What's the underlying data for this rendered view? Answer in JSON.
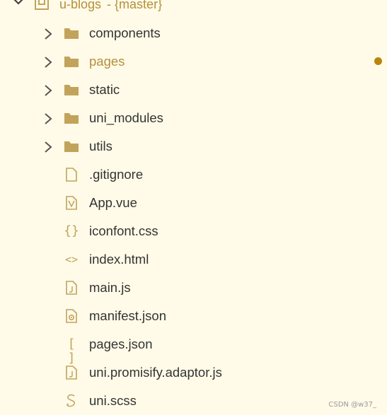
{
  "root": {
    "name": "u-blogs",
    "branch": "- {master}",
    "expanded": true
  },
  "items": [
    {
      "label": "components",
      "type": "folder",
      "icon": "folder-icon"
    },
    {
      "label": "pages",
      "type": "folder",
      "icon": "folder-icon",
      "modified": true
    },
    {
      "label": "static",
      "type": "folder",
      "icon": "folder-icon"
    },
    {
      "label": "uni_modules",
      "type": "folder",
      "icon": "folder-icon"
    },
    {
      "label": "utils",
      "type": "folder",
      "icon": "folder-icon"
    },
    {
      "label": ".gitignore",
      "type": "file",
      "icon": "file-icon"
    },
    {
      "label": "App.vue",
      "type": "file",
      "icon": "vue-file-icon"
    },
    {
      "label": "iconfont.css",
      "type": "file",
      "icon": "css-braces-icon"
    },
    {
      "label": "index.html",
      "type": "file",
      "icon": "html-brackets-icon"
    },
    {
      "label": "main.js",
      "type": "file",
      "icon": "js-file-icon"
    },
    {
      "label": "manifest.json",
      "type": "file",
      "icon": "manifest-gear-icon"
    },
    {
      "label": "pages.json",
      "type": "file",
      "icon": "json-brackets-icon"
    },
    {
      "label": "uni.promisify.adaptor.js",
      "type": "file",
      "icon": "js-file-icon"
    },
    {
      "label": "uni.scss",
      "type": "file",
      "icon": "scss-icon"
    }
  ],
  "watermark": "CSDN @w37_",
  "colors": {
    "background": "#fffbe8",
    "folder": "#c2a35c",
    "modified_text": "#b58f3c",
    "modified_dot": "#b8860b",
    "text": "#333333"
  }
}
